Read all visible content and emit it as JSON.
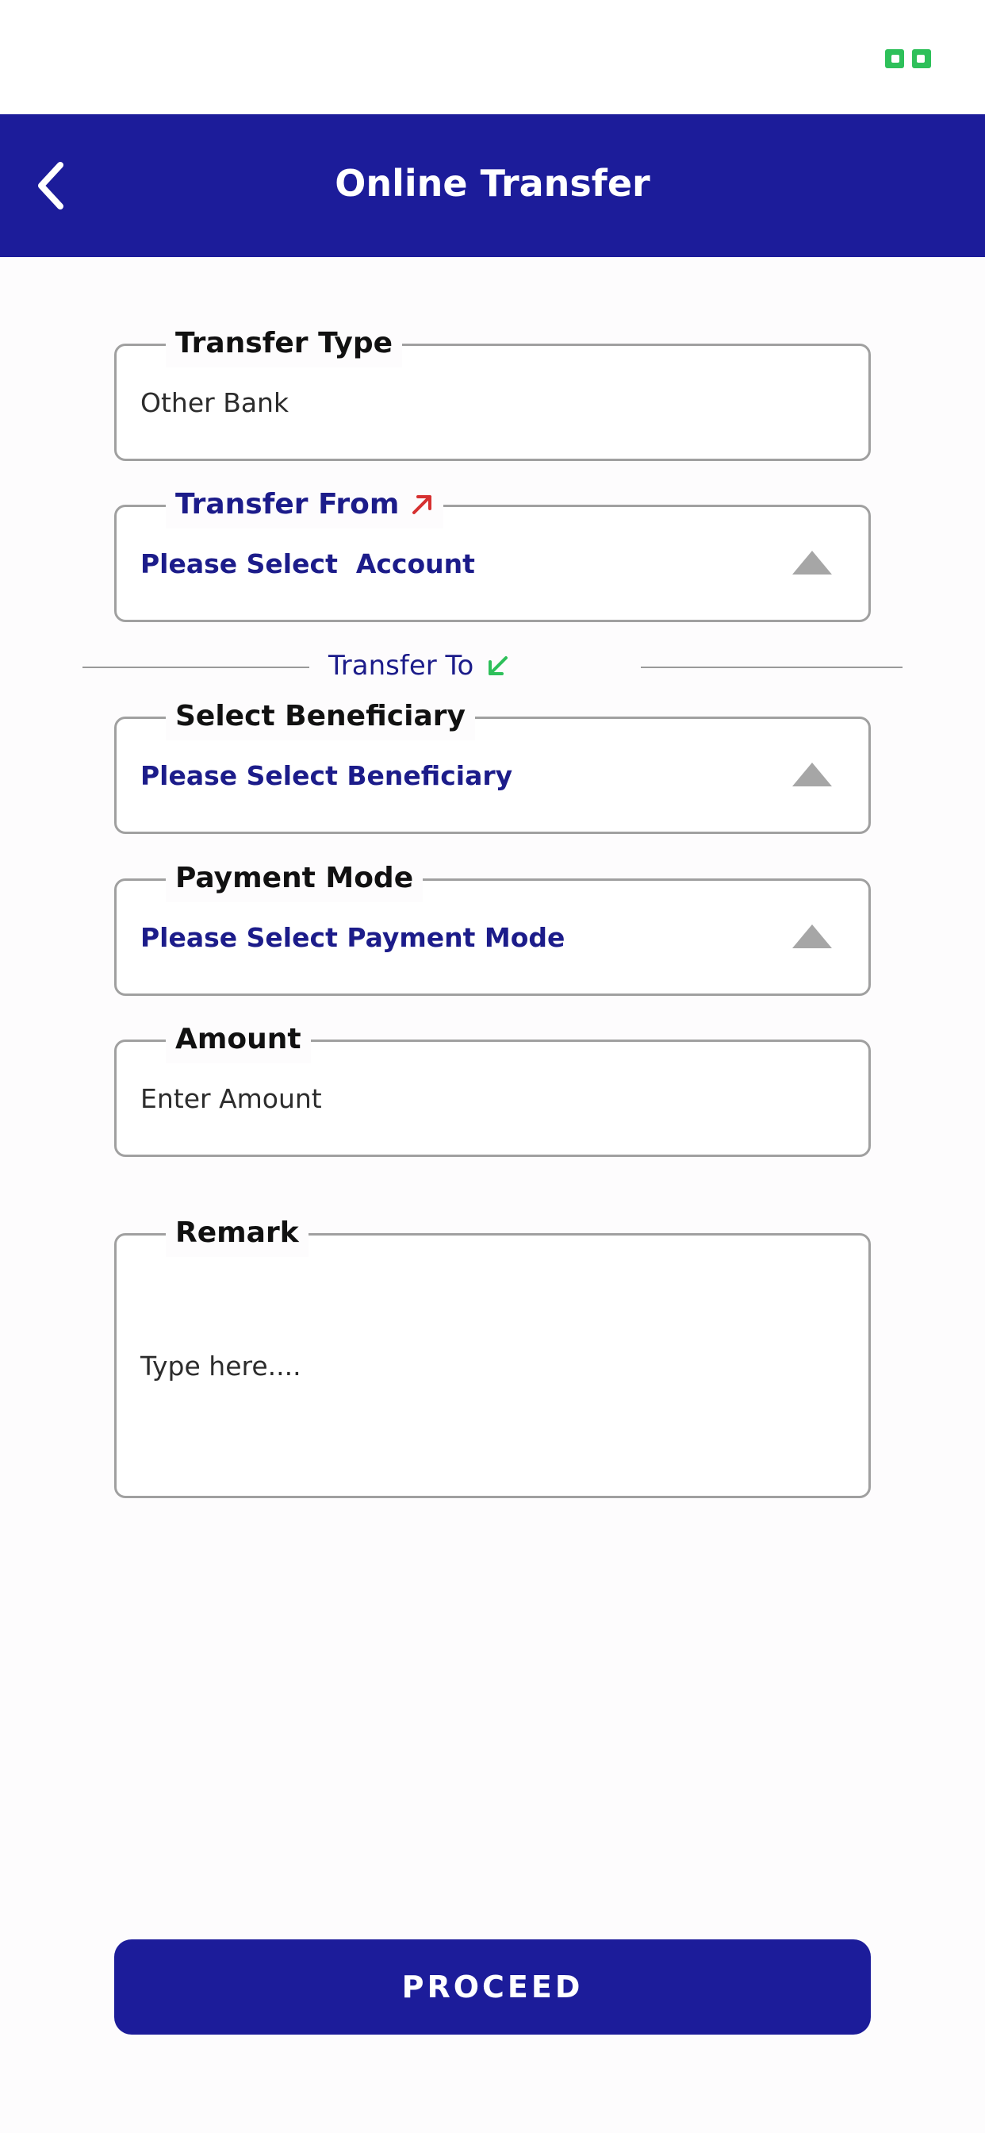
{
  "status_bar": {
    "right_icon": "battery-icon"
  },
  "header": {
    "back_icon": "chevron-left-icon",
    "title": "Online Transfer"
  },
  "form": {
    "transfer_type": {
      "label": "Transfer Type",
      "value": "Other Bank"
    },
    "transfer_from": {
      "label": "Transfer From",
      "icon": "arrow-up-right-icon",
      "value": "Please Select  Account"
    },
    "transfer_to": {
      "label": "Transfer To",
      "icon": "arrow-down-left-icon"
    },
    "beneficiary": {
      "label": "Select Beneficiary",
      "value": "Please Select Beneficiary"
    },
    "payment_mode": {
      "label": "Payment Mode",
      "value": "Please Select Payment Mode"
    },
    "amount": {
      "label": "Amount",
      "placeholder": "Enter Amount"
    },
    "remark": {
      "label": "Remark",
      "placeholder": "Type here...."
    }
  },
  "actions": {
    "proceed_label": "PROCEED"
  },
  "colors": {
    "primary": "#1c1c9a",
    "accent_red": "#d63030",
    "accent_green": "#2ec05a"
  }
}
